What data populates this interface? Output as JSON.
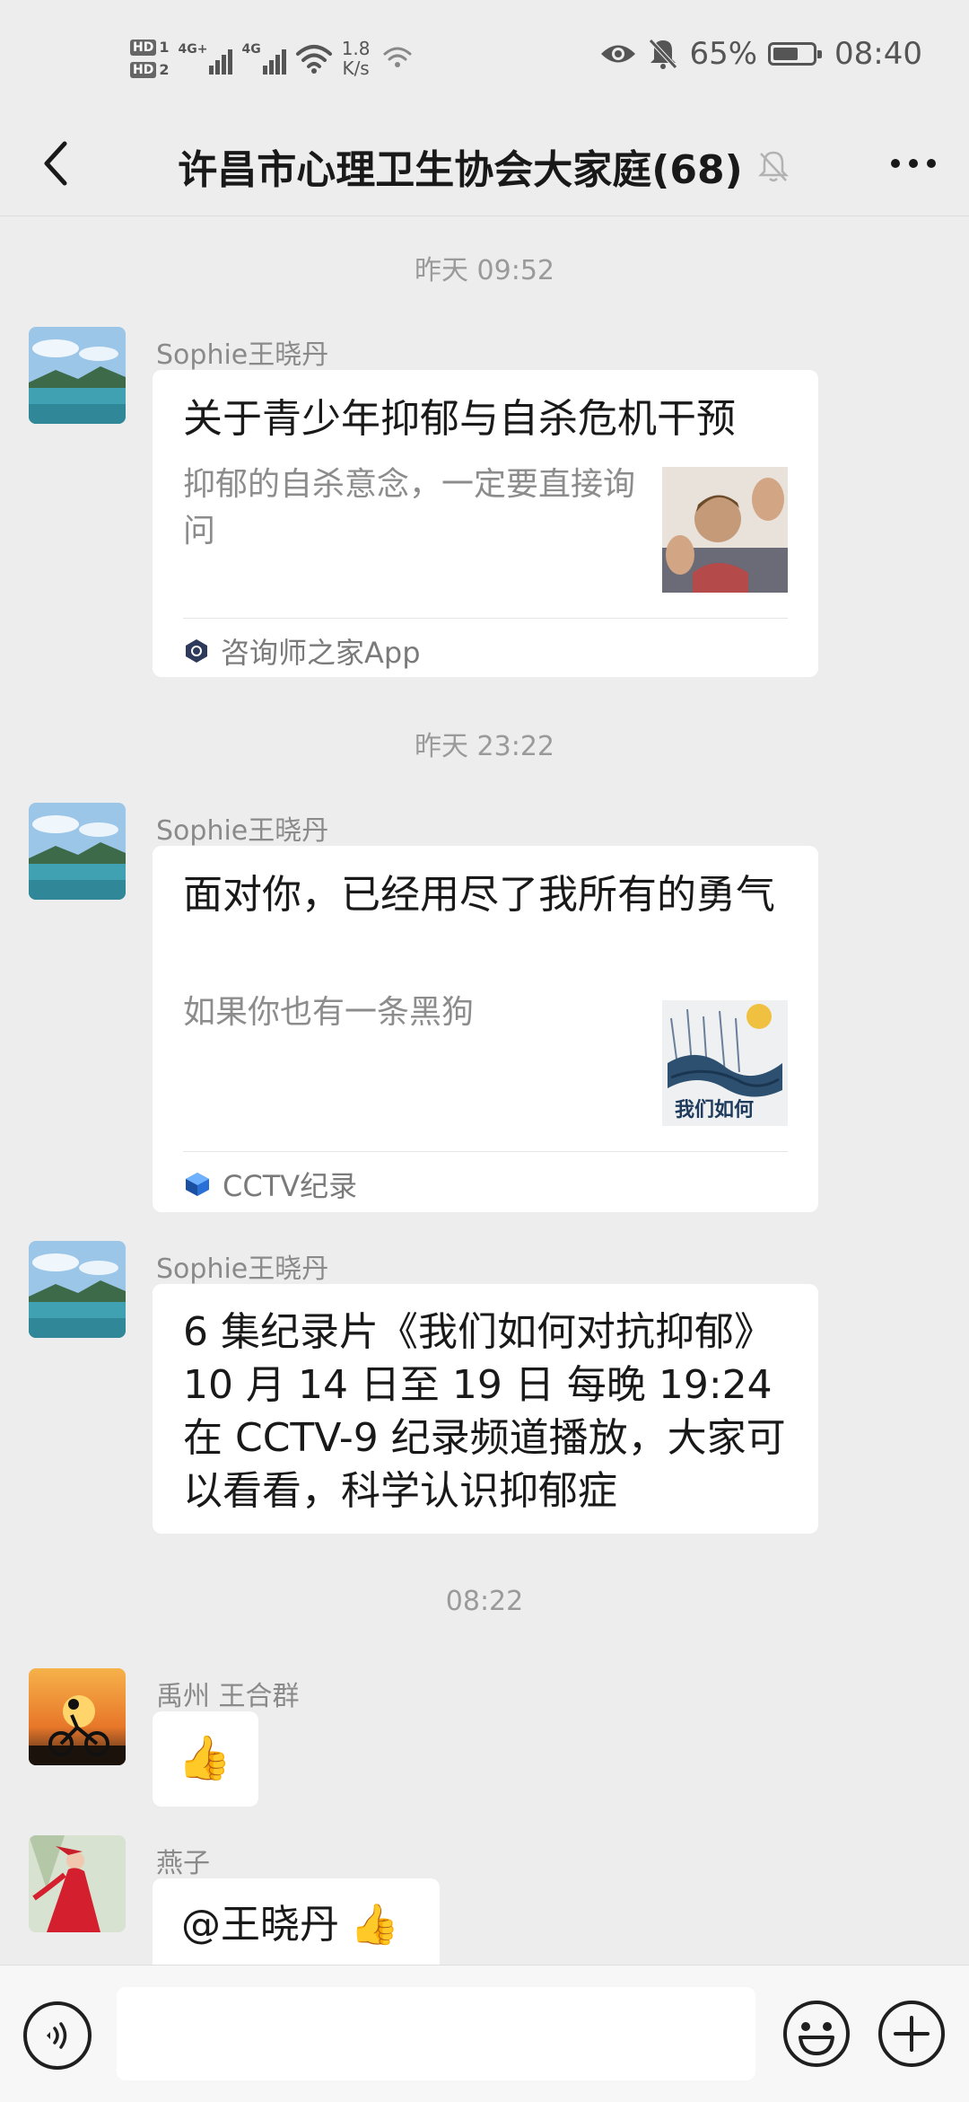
{
  "status_bar": {
    "hd1": "HD",
    "hd1_num": "1",
    "hd2": "HD",
    "hd2_num": "2",
    "net1": "4G+",
    "net2": "4G",
    "speed_value": "1.8",
    "speed_unit": "K/s",
    "battery_percent": "65%",
    "battery_level": 0.65,
    "time": "08:40"
  },
  "header": {
    "title": "许昌市心理卫生协会大家庭(68)"
  },
  "messages": [
    {
      "timestamp": "昨天 09:52",
      "sender": "Sophie王晓丹",
      "card_title": "关于青少年抑郁与自杀危机干预",
      "card_desc": "抑郁的自杀意念，一定要直接询问",
      "card_source": "咨询师之家App"
    },
    {
      "timestamp": "昨天 23:22",
      "sender": "Sophie王晓丹",
      "card_title": "面对你，已经用尽了我所有的勇气",
      "card_desc": "如果你也有一条黑狗",
      "card_thumb_text": "我们如何",
      "card_source": "CCTV纪录"
    },
    {
      "sender": "Sophie王晓丹",
      "text": "6 集纪录片《我们如何对抗抑郁》10 月 14 日至 19 日 每晚 19:24 在 CCTV-9 纪录频道播放，大家可以看看，科学认识抑郁症"
    },
    {
      "timestamp": "08:22",
      "sender": "禹州  王合群",
      "emoji": "👍"
    },
    {
      "sender": "燕子",
      "text": "@王晓丹 ",
      "emoji": "👍"
    }
  ],
  "colors": {
    "background": "#ededed",
    "bubble": "#ffffff",
    "muted_text": "#8a8a8a"
  },
  "icons": {
    "back": "chevron-left-icon",
    "mute": "bell-off-icon",
    "more": "more-dots-icon",
    "voice": "voice-icon",
    "emoji": "smiley-icon",
    "plus": "plus-icon"
  }
}
